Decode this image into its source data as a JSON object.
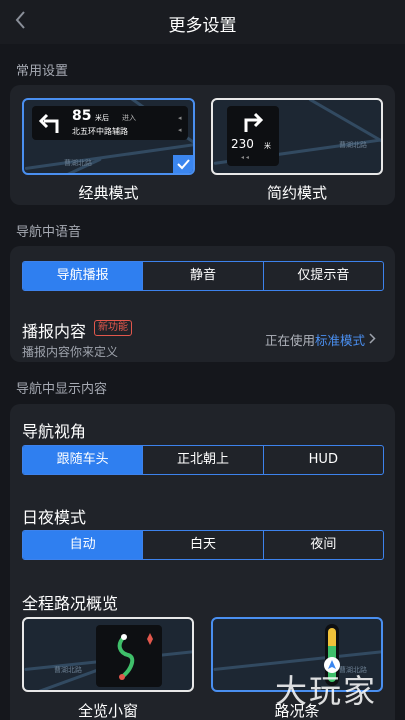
{
  "header": {
    "title": "更多设置"
  },
  "sections": {
    "common": "常用设置",
    "voice": "导航中语音",
    "display": "导航中显示内容"
  },
  "modes": {
    "classic": {
      "label": "经典模式",
      "distance": "85",
      "unit": "米后",
      "enter": "进入",
      "road": "北五环中路辅路"
    },
    "simple": {
      "label": "简约模式",
      "distance": "230",
      "unit": "米"
    },
    "map_road": "曹湖北路"
  },
  "voice": {
    "options": [
      "导航播报",
      "静音",
      "仅提示音"
    ],
    "selected": 0,
    "broadcast_title": "播报内容",
    "new_badge": "新功能",
    "broadcast_desc": "播报内容你来定义",
    "using_prefix": "正在使用",
    "using_mode": "标准模式"
  },
  "display": {
    "view_angle": {
      "title": "导航视角",
      "options": [
        "跟随车头",
        "正北朝上",
        "HUD"
      ],
      "selected": 0
    },
    "day_night": {
      "title": "日夜模式",
      "options": [
        "自动",
        "白天",
        "夜间"
      ],
      "selected": 0
    },
    "overview": {
      "title": "全程路况概览",
      "small_window": "全览小窗",
      "traffic_bar": "路况条"
    }
  },
  "watermark": "大玩家",
  "colors": {
    "accent": "#2f7ff0",
    "badge": "#e2574c",
    "link": "#4a8ff0"
  }
}
